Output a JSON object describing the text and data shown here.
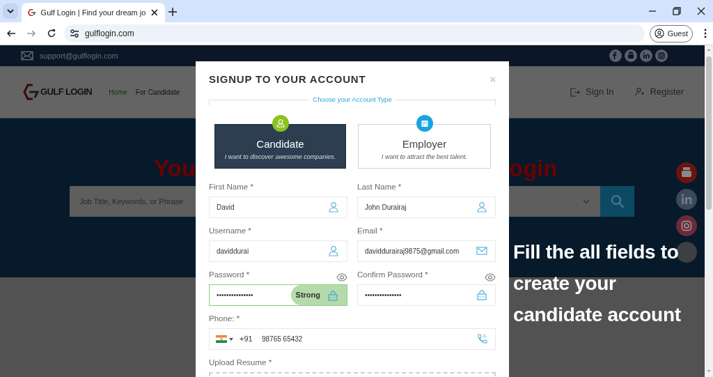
{
  "browser": {
    "tabs": [
      {
        "title": "Gulf Login | Find your dream jo",
        "selected": true
      }
    ],
    "url": "gulflogin.com",
    "profile": "Guest"
  },
  "page": {
    "top_bar": {
      "email": "support@gulflogin.com"
    },
    "header": {
      "logo": "GULF LOGIN",
      "nav": [
        {
          "label": "Home",
          "selected": true
        },
        {
          "label": "For Candidate",
          "selected": false
        }
      ],
      "actions": [
        {
          "kind": "signin",
          "label": "Sign In"
        },
        {
          "kind": "register",
          "label": "Register"
        }
      ]
    },
    "hero": {
      "title_left": "You",
      "title_right": "ogin",
      "search": {
        "placeholder": "Job Title, Keywords, or Phrase"
      }
    }
  },
  "modal": {
    "title": "SIGNUP TO YOUR ACCOUNT",
    "close": "×",
    "legend": "Choose your Account Type",
    "account_types": [
      {
        "kind": "candidate",
        "title": "Candidate",
        "subtitle": "I want to discover awesome companies.",
        "selected": true
      },
      {
        "kind": "employer",
        "title": "Employer",
        "subtitle": "I want to attract the best talent.",
        "selected": false
      }
    ],
    "fields": [
      {
        "kind": "name",
        "label": "First Name *",
        "value": "David"
      },
      {
        "kind": "name",
        "label": "Last Name *",
        "value": "John Durairaj"
      },
      {
        "kind": "name",
        "label": "Username *",
        "value": "daviddurai"
      },
      {
        "kind": "email",
        "label": "Email *",
        "value": "daviddurairaj9875@gmail.com"
      },
      {
        "kind": "password",
        "label": "Password *",
        "value": "•••••••••••••••",
        "strength": "Strong"
      },
      {
        "kind": "password",
        "label": "Confirm Password *",
        "value": "•••••••••••••••"
      },
      {
        "kind": "phone",
        "label": "Phone: *",
        "dial_code": "+91",
        "value": "98765 65432"
      },
      {
        "kind": "upload",
        "label": "Upload Resume *"
      }
    ]
  },
  "caption": {
    "lines": [
      "Fill the all fields to",
      "create your",
      "candidate account"
    ]
  }
}
